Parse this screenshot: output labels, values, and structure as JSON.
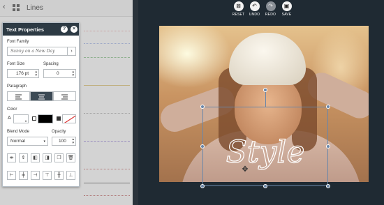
{
  "library": {
    "title": "Lines",
    "back_icon": "chevron-left-icon",
    "grid_icon": "grid-icon",
    "line_colors": [
      "#c9a0a0",
      "#9aa6c6",
      "#8fb08f",
      "#c0b080",
      "#a0a0a0",
      "#9a8fbf",
      "#b07a7a",
      "#7a7a7a",
      "#b07a7a"
    ]
  },
  "toolbar": {
    "buttons": [
      {
        "icon": "reset-icon",
        "label": "RESET"
      },
      {
        "icon": "undo-icon",
        "label": "UNDO"
      },
      {
        "icon": "redo-icon",
        "label": "REDO"
      },
      {
        "icon": "save-icon",
        "label": "SAVE"
      }
    ]
  },
  "canvas": {
    "overlay_text": "Style",
    "selection_color": "#6a86a8"
  },
  "panel": {
    "title": "Text Properties",
    "help_label": "?",
    "close_label": "×",
    "font_family_label": "Font Family",
    "font_family_value": "Sunny on a New Day",
    "font_size_label": "Font Size",
    "font_size_value": "176 pt",
    "spacing_label": "Spacing",
    "spacing_value": "0",
    "paragraph_label": "Paragraph",
    "paragraph_options": [
      "align-left-icon",
      "align-center-icon",
      "align-right-icon"
    ],
    "paragraph_selected": "align-center-icon",
    "color_label": "Color",
    "text_color_letter": "A",
    "text_color": "#ffffff",
    "fill_color": "#000000",
    "stroke_color": "#ffffff",
    "blend_mode_label": "Blend Mode",
    "blend_mode_value": "Normal",
    "opacity_label": "Opacity",
    "opacity_value": "100",
    "accent_dark": "#2d3a44"
  }
}
